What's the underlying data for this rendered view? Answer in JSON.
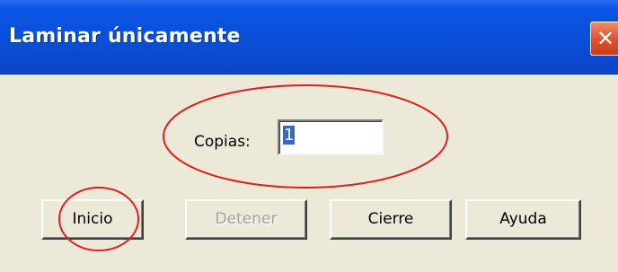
{
  "window": {
    "title": "Laminar únicamente",
    "close_glyph": "✕"
  },
  "form": {
    "copies_label": "Copias:",
    "copies_value": "1"
  },
  "buttons": {
    "start": "Inicio",
    "stop": "Detener",
    "close": "Cierre",
    "help": "Ayuda"
  },
  "colors": {
    "titlebar": "#0a4fd8",
    "annotation": "#e02020",
    "dialog_bg": "#ece9d8"
  }
}
